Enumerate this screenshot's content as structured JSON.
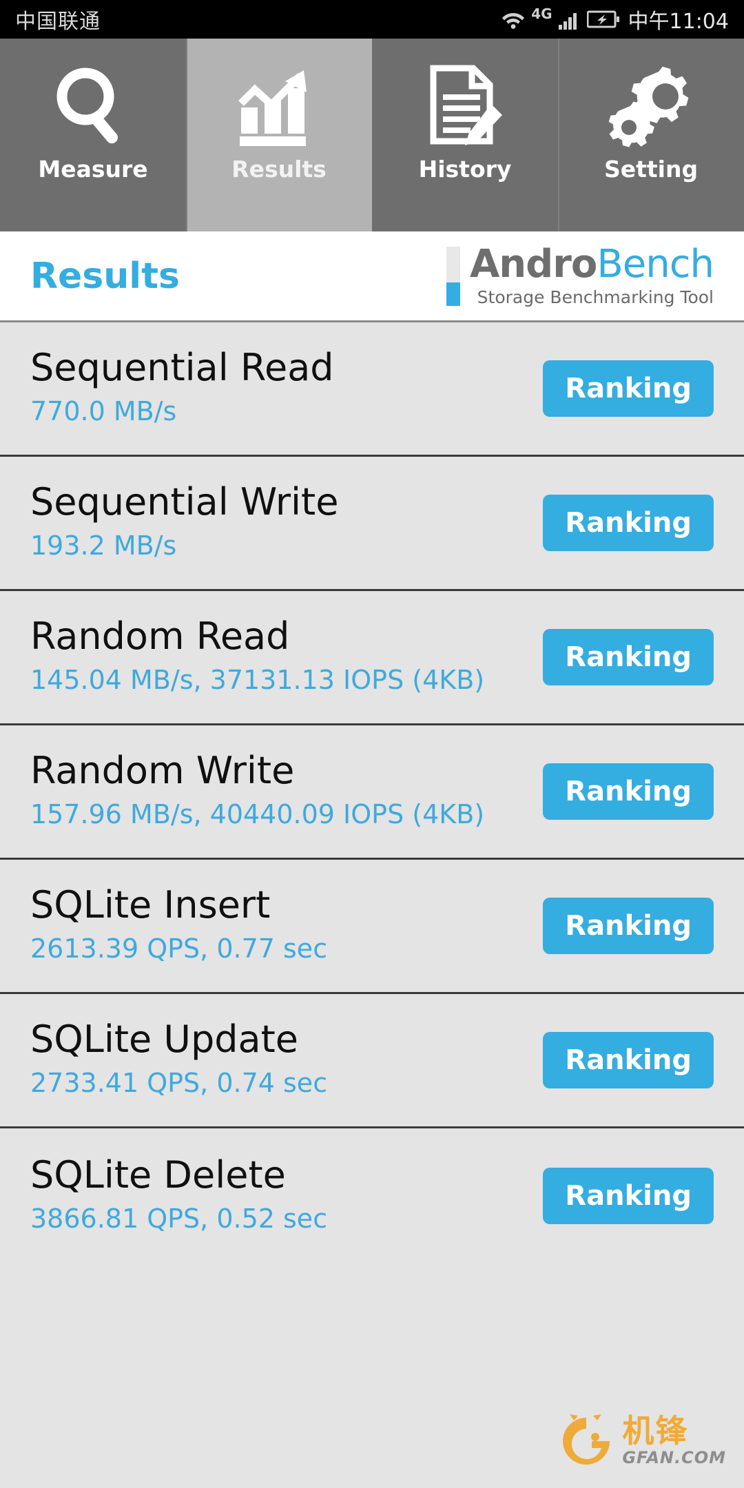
{
  "statusbar": {
    "carrier": "中国联通",
    "network": "4G",
    "clock": "中午11:04",
    "icons": [
      "wifi-icon",
      "network-4g-icon",
      "signal-bars-icon",
      "battery-charging-icon"
    ]
  },
  "tabs": [
    {
      "label": "Measure",
      "icon": "magnifier-icon",
      "active": false
    },
    {
      "label": "Results",
      "icon": "bar-chart-arrow-icon",
      "active": true
    },
    {
      "label": "History",
      "icon": "document-pencil-icon",
      "active": false
    },
    {
      "label": "Setting",
      "icon": "gears-icon",
      "active": false
    }
  ],
  "header": {
    "title": "Results",
    "logo_main_first": "Andro",
    "logo_main_second": "Bench",
    "logo_tagline": "Storage Benchmarking Tool"
  },
  "colors": {
    "accent": "#34ade0",
    "value_text": "#3fa9dc",
    "list_bg": "#e4e4e4",
    "tab_bg": "#6e6e6e",
    "tab_active_bg": "#b3b3b3",
    "watermark_orange": "#f0a830"
  },
  "results": {
    "button_label": "Ranking",
    "rows": [
      {
        "title": "Sequential Read",
        "value": "770.0 MB/s"
      },
      {
        "title": "Sequential Write",
        "value": "193.2 MB/s"
      },
      {
        "title": "Random Read",
        "value": "145.04 MB/s, 37131.13 IOPS (4KB)"
      },
      {
        "title": "Random Write",
        "value": "157.96 MB/s, 40440.09 IOPS (4KB)"
      },
      {
        "title": "SQLite Insert",
        "value": "2613.39 QPS, 0.77 sec"
      },
      {
        "title": "SQLite Update",
        "value": "2733.41 QPS, 0.74 sec"
      },
      {
        "title": "SQLite Delete",
        "value": "3866.81 QPS, 0.52 sec"
      }
    ]
  },
  "watermark": {
    "cn": "机锋",
    "en": "GFAN.COM"
  }
}
